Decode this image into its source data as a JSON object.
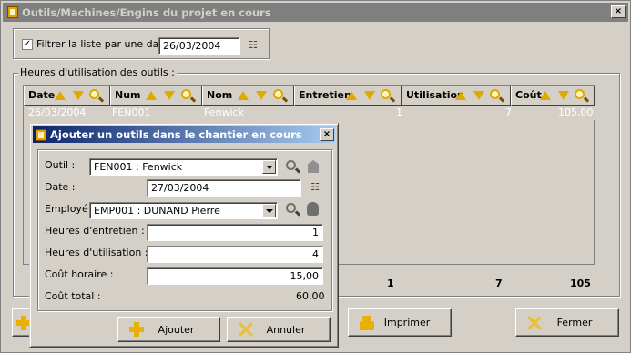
{
  "main_window": {
    "title": "Outils/Machines/Engins du projet en cours",
    "close_glyph": "×"
  },
  "filter": {
    "checkbox_label": "Filtrer la liste par une date",
    "checked_glyph": "✓",
    "date_value": "26/03/2004"
  },
  "usage_group": {
    "label": "Heures d'utilisation des outils :"
  },
  "table": {
    "columns": [
      "Date",
      "Num",
      "Nom",
      "Entretien",
      "Utilisation",
      "Coût"
    ],
    "rows": [
      {
        "date": "26/03/2004",
        "num": "FEN001",
        "nom": "Fenwick",
        "entretien": "1",
        "utilisation": "7",
        "cout": "105,00"
      }
    ],
    "totals": {
      "entretien": "1",
      "utilisation": "7",
      "cout": "105"
    }
  },
  "buttons": {
    "print_label": "Imprimer",
    "close_label": "Fermer"
  },
  "dialog": {
    "title": "Ajouter un outils dans le chantier en cours",
    "close_glyph": "×",
    "outil_label": "Outil :",
    "outil_value": "FEN001 : Fenwick",
    "date_label": "Date :",
    "date_value": "27/03/2004",
    "employe_label": "Employé :",
    "employe_value": "EMP001 : DUNAND Pierre",
    "entretien_label": "Heures d'entretien :",
    "entretien_value": "1",
    "utilisation_label": "Heures d'utilisation :",
    "utilisation_value": "4",
    "cout_horaire_label": "Coût horaire :",
    "cout_horaire_value": "15,00",
    "cout_total_label": "Coût total :",
    "cout_total_value": "60,00",
    "add_label": "Ajouter",
    "cancel_label": "Annuler"
  },
  "icons": {
    "calendar": "calendar-icon",
    "search": "magnifier-icon",
    "sort_up": "sort-ascending-icon",
    "sort_down": "sort-descending-icon",
    "add": "plus-icon",
    "cancel": "cross-icon",
    "print": "printer-icon",
    "app": "toolbox-icon",
    "person": "person-icon",
    "building": "building-icon"
  },
  "colors": {
    "face": "#d4d0c8",
    "inactive_title": "#808080",
    "active_title_start": "#0a246a",
    "active_title_end": "#a6caf0",
    "accent_icon": "#e0a800"
  }
}
